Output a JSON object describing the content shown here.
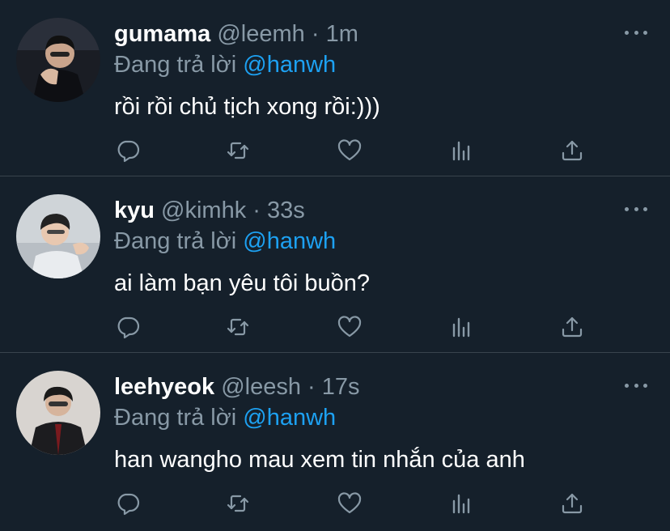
{
  "colors": {
    "background": "#15202b",
    "divider": "#38444d",
    "secondary_text": "#8899a6",
    "accent": "#1da1f2",
    "primary_text": "#ffffff"
  },
  "tweets": [
    {
      "name": "gumama",
      "handle": "@leemh",
      "separator": "·",
      "time": "1m",
      "reply_prefix": "Đang trả lời",
      "reply_to": "@hanwh",
      "text": "rồi rồi chủ tịch xong rồi:)))",
      "avatar_icon": "user-avatar"
    },
    {
      "name": "kyu",
      "handle": "@kimhk",
      "separator": "·",
      "time": "33s",
      "reply_prefix": "Đang trả lời",
      "reply_to": "@hanwh",
      "text": "ai làm bạn yêu tôi buồn?",
      "avatar_icon": "user-avatar"
    },
    {
      "name": "leehyeok",
      "handle": "@leesh",
      "separator": "·",
      "time": "17s",
      "reply_prefix": "Đang trả lời",
      "reply_to": "@hanwh",
      "text": "han wangho mau xem tin nhắn của anh",
      "avatar_icon": "user-avatar"
    }
  ],
  "action_icons": [
    "reply-icon",
    "retweet-icon",
    "like-icon",
    "analytics-icon",
    "share-icon"
  ]
}
